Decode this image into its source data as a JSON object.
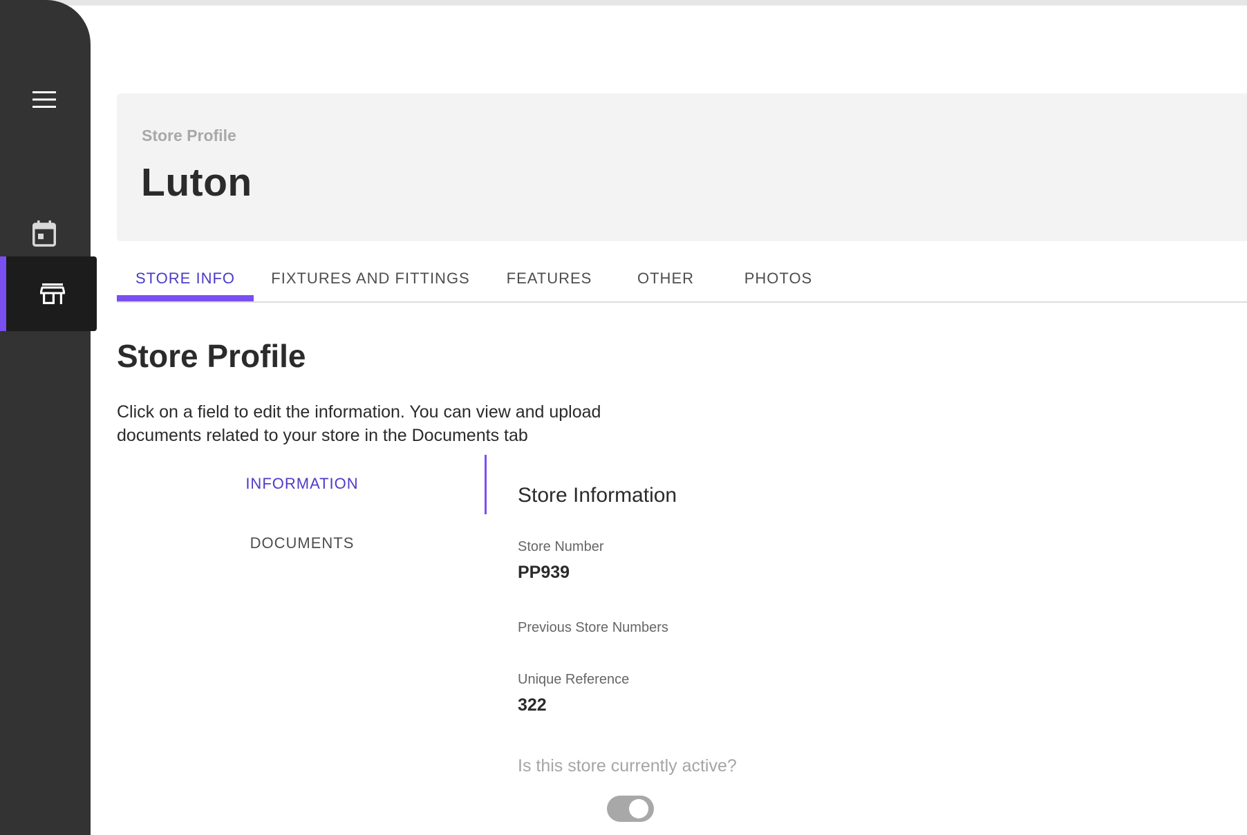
{
  "sidebar": {
    "icons": [
      "menu-icon",
      "calendar-icon",
      "store-icon"
    ],
    "accent_color": "#7a4ff2"
  },
  "header": {
    "eyebrow": "Store Profile",
    "title": "Luton"
  },
  "tabs": [
    {
      "label": "STORE INFO",
      "active": true
    },
    {
      "label": "FIXTURES AND FITTINGS",
      "active": false
    },
    {
      "label": "FEATURES",
      "active": false
    },
    {
      "label": "OTHER",
      "active": false
    },
    {
      "label": "PHOTOS",
      "active": false
    }
  ],
  "section": {
    "title": "Store Profile",
    "intro": "Click on a field to edit the information. You can view and upload documents related to your store in the Documents tab"
  },
  "subnav": [
    {
      "label": "INFORMATION",
      "active": true
    },
    {
      "label": "DOCUMENTS",
      "active": false
    }
  ],
  "panel": {
    "title": "Store Information",
    "fields": {
      "store_number": {
        "label": "Store Number",
        "value": "PP939"
      },
      "previous_store_numbers": {
        "label": "Previous Store Numbers",
        "value": ""
      },
      "unique_reference": {
        "label": "Unique Reference",
        "value": "322"
      }
    },
    "active_question": "Is this store currently active?",
    "active_toggle": true
  }
}
